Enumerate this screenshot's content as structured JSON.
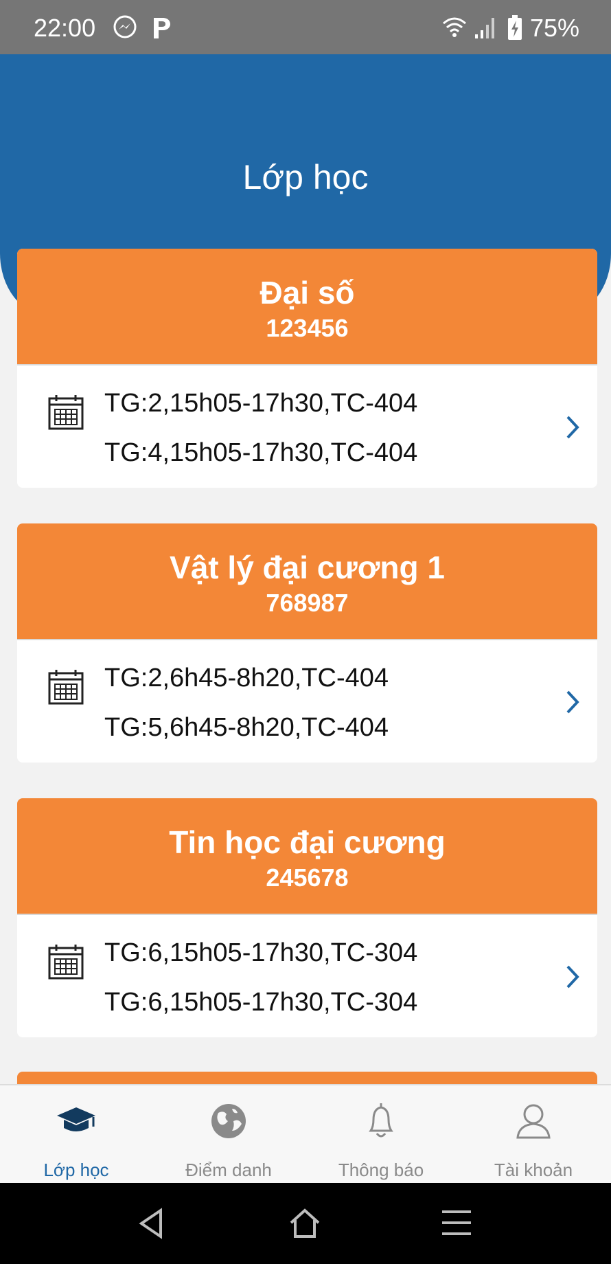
{
  "status_bar": {
    "time": "22:00",
    "battery": "75%"
  },
  "header": {
    "title": "Lớp học"
  },
  "classes": [
    {
      "name": "Đại số",
      "code": "123456",
      "schedule": [
        "TG:2,15h05-17h30,TC-404",
        "TG:4,15h05-17h30,TC-404"
      ]
    },
    {
      "name": "Vật lý đại cương 1",
      "code": "768987",
      "schedule": [
        "TG:2,6h45-8h20,TC-404",
        "TG:5,6h45-8h20,TC-404"
      ]
    },
    {
      "name": "Tin học đại cương",
      "code": "245678",
      "schedule": [
        "TG:6,15h05-17h30,TC-304",
        "TG:6,15h05-17h30,TC-304"
      ]
    }
  ],
  "bottom_nav": {
    "items": [
      {
        "label": "Lớp học",
        "icon": "graduation-cap-icon",
        "active": true
      },
      {
        "label": "Điểm danh",
        "icon": "globe-icon",
        "active": false
      },
      {
        "label": "Thông báo",
        "icon": "bell-icon",
        "active": false
      },
      {
        "label": "Tài khoản",
        "icon": "user-icon",
        "active": false
      }
    ]
  },
  "colors": {
    "status_bar": "#767676",
    "header": "#2068a6",
    "card_header": "#f38737",
    "accent": "#2068a6",
    "inactive": "#8a8a8a"
  }
}
